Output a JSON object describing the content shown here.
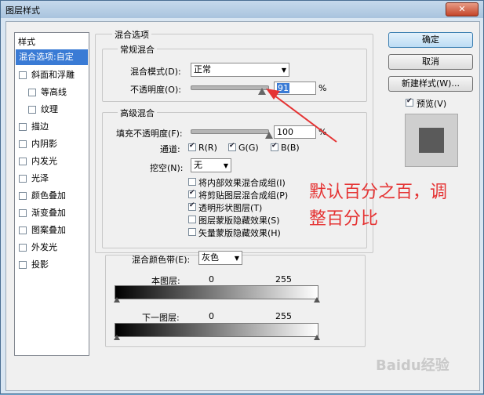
{
  "window": {
    "title": "图层样式",
    "close_glyph": "✕"
  },
  "sidebar": {
    "header": "样式",
    "items": [
      {
        "label": "混合选项:自定",
        "selected": true
      },
      {
        "label": "斜面和浮雕"
      },
      {
        "label": "等高线",
        "indent": true
      },
      {
        "label": "纹理",
        "indent": true
      },
      {
        "label": "描边"
      },
      {
        "label": "内阴影"
      },
      {
        "label": "内发光"
      },
      {
        "label": "光泽"
      },
      {
        "label": "颜色叠加"
      },
      {
        "label": "渐变叠加"
      },
      {
        "label": "图案叠加"
      },
      {
        "label": "外发光"
      },
      {
        "label": "投影"
      }
    ]
  },
  "blend": {
    "section_title": "混合选项",
    "normal": {
      "legend": "常规混合",
      "mode_label": "混合模式(D):",
      "mode_value": "正常",
      "opacity_label": "不透明度(O):",
      "opacity_value": "91",
      "opacity_fraction": 0.91,
      "percent": "%"
    },
    "advanced": {
      "legend": "高级混合",
      "fill_label": "填充不透明度(F):",
      "fill_value": "100",
      "fill_fraction": 1.0,
      "percent": "%",
      "channels_label": "通道:",
      "ch_r": "R(R)",
      "ch_g": "G(G)",
      "ch_b": "B(B)",
      "knockout_label": "挖空(N):",
      "knockout_value": "无",
      "opt1": "将内部效果混合成组(I)",
      "opt2": "将剪贴图层混合成组(P)",
      "opt3": "透明形状图层(T)",
      "opt4": "图层蒙版隐藏效果(S)",
      "opt5": "矢量蒙版隐藏效果(H)"
    },
    "blend_if": {
      "label": "混合颜色带(E):",
      "value": "灰色",
      "this_layer": "本图层:",
      "under_layer": "下一图层:",
      "min": "0",
      "max": "255"
    }
  },
  "buttons": {
    "ok": "确定",
    "cancel": "取消",
    "new_style": "新建样式(W)...",
    "preview": "预览(V)"
  },
  "annotation": {
    "line1": "默认百分之百，调",
    "line2": "整百分比",
    "color": "#e53333"
  },
  "watermark": "Baidu经验"
}
